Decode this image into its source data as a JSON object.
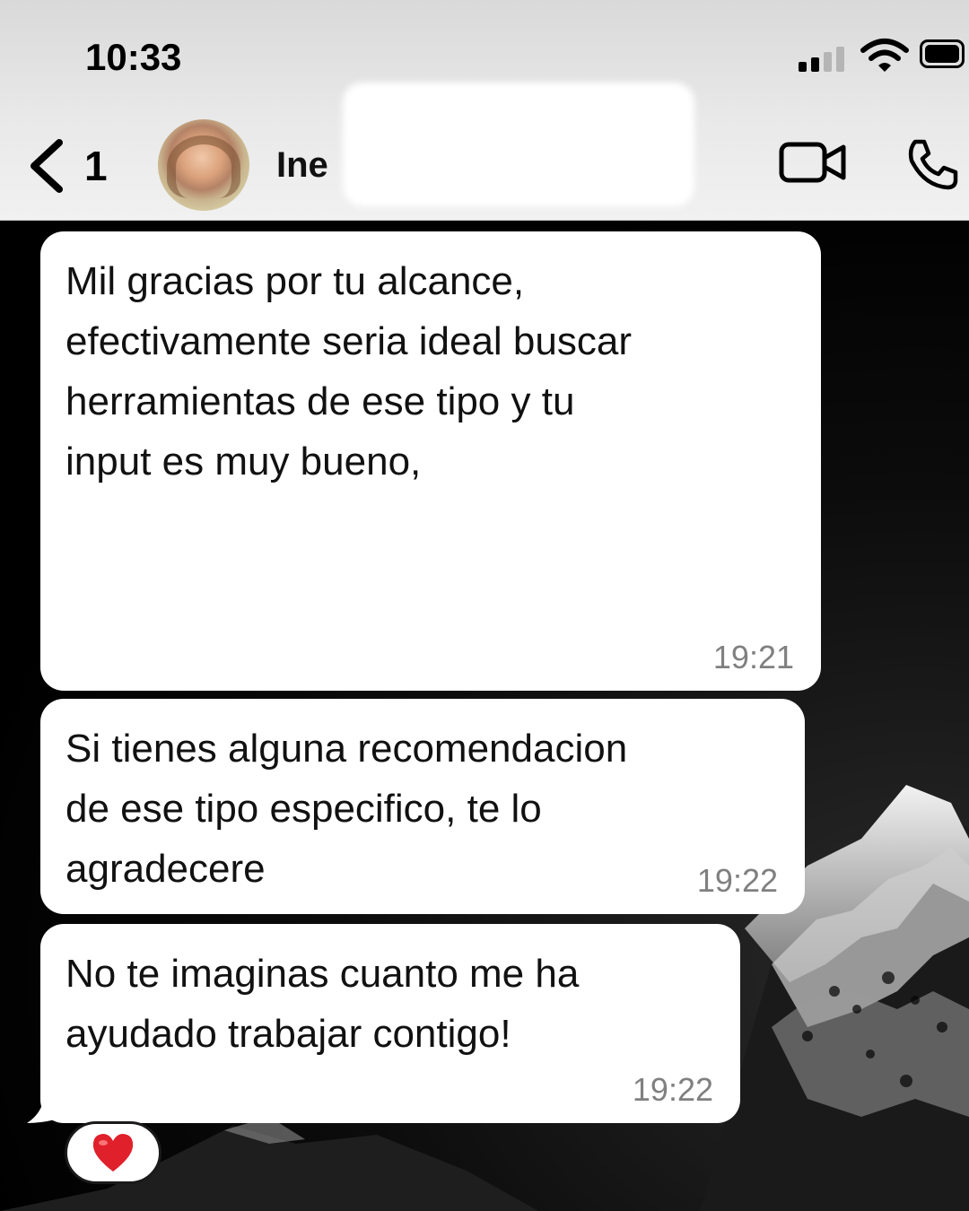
{
  "status_bar": {
    "time": "10:33"
  },
  "header": {
    "back_count": "1",
    "contact_name": "Ine",
    "icons": {
      "back": "chevron-left-icon",
      "video": "video-camera-icon",
      "phone": "phone-icon"
    }
  },
  "messages": [
    {
      "text": "Mil gracias por tu alcance,\nefectivamente seria ideal buscar\nherramientas de ese tipo y tu\ninput es  muy bueno,",
      "time": "19:21"
    },
    {
      "text": "Si tienes alguna recomendacion\nde ese tipo especifico, te lo\nagradecere",
      "time": "19:22"
    },
    {
      "text": "No te imaginas cuanto me ha\nayudado trabajar contigo!",
      "time": "19:22"
    }
  ],
  "reaction": {
    "emoji": "❤️",
    "icon": "heart-icon"
  },
  "colors": {
    "bubble": "#ffffff",
    "header_bg": "#e9e9e9",
    "time_text": "#808080",
    "reaction_heart": "#e0202a"
  }
}
